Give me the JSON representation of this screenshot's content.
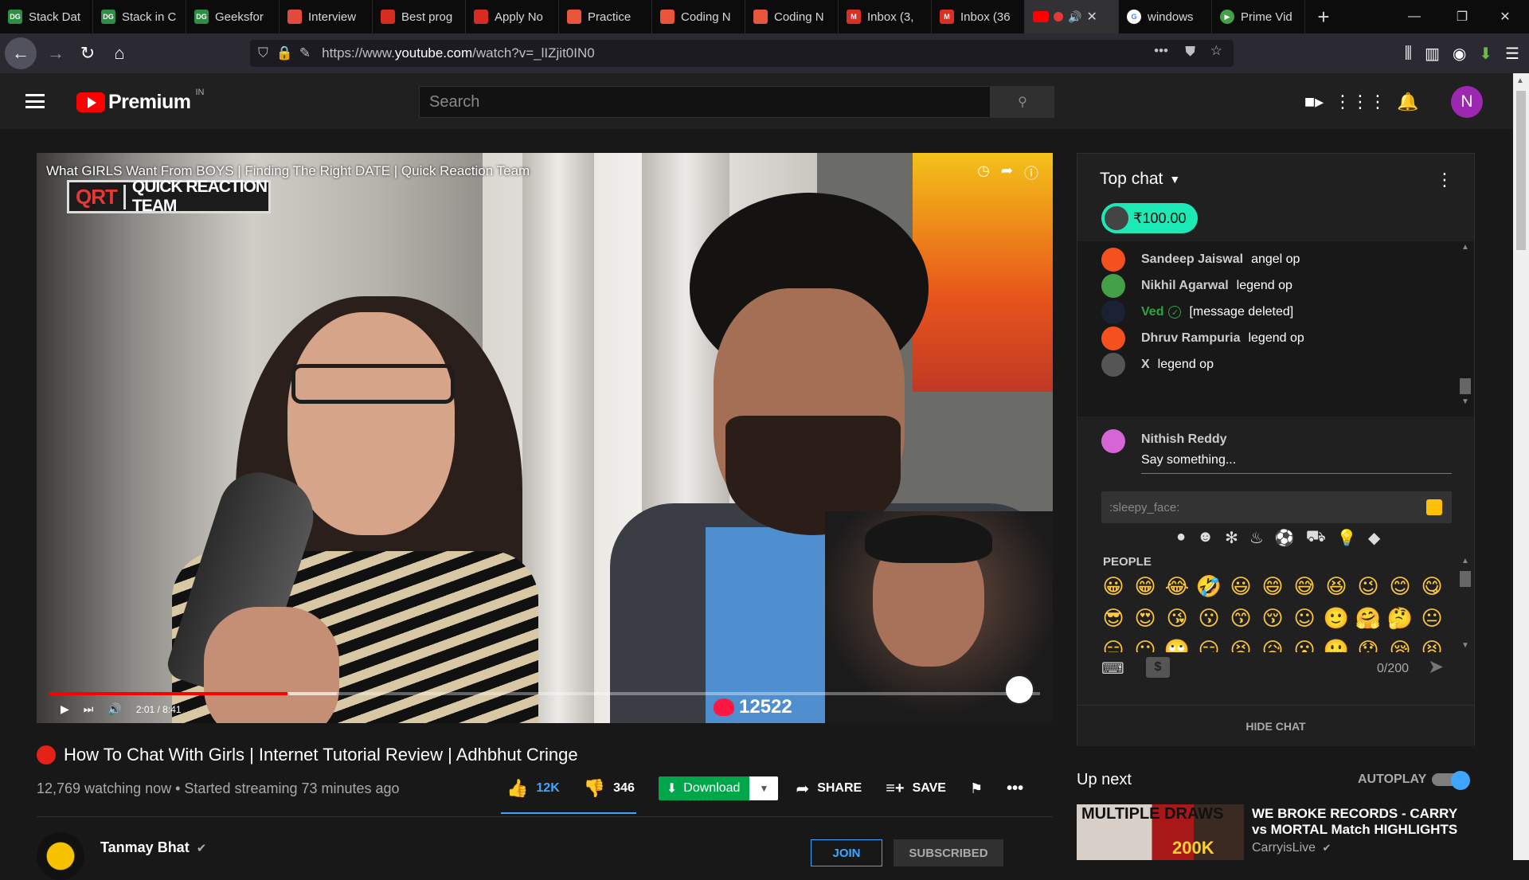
{
  "browser": {
    "tabs": [
      {
        "label": "Stack Dat",
        "icon": "gfg-favicon",
        "color": "#2f8d46",
        "abbr": "DG"
      },
      {
        "label": "Stack in C",
        "icon": "gfg-favicon",
        "color": "#2f8d46",
        "abbr": "DG"
      },
      {
        "label": "Geeksfor",
        "icon": "gfg-favicon",
        "color": "#2f8d46",
        "abbr": "DG"
      },
      {
        "label": "Interview",
        "icon": "interviewbit-favicon",
        "color": "#e24b3b",
        "abbr": ""
      },
      {
        "label": "Best prog",
        "icon": "red-favicon",
        "color": "#d62d20",
        "abbr": ""
      },
      {
        "label": "Apply No",
        "icon": "red-favicon",
        "color": "#d62d20",
        "abbr": ""
      },
      {
        "label": "Practice",
        "icon": "coding-favicon",
        "color": "#e8553b",
        "abbr": ""
      },
      {
        "label": "Coding N",
        "icon": "coding-favicon",
        "color": "#e8553b",
        "abbr": ""
      },
      {
        "label": "Coding N",
        "icon": "coding-favicon",
        "color": "#e8553b",
        "abbr": ""
      },
      {
        "label": "Inbox (3,",
        "icon": "gmail-favicon",
        "color": "#d93025",
        "abbr": "M"
      },
      {
        "label": "Inbox (36",
        "icon": "gmail-favicon",
        "color": "#d93025",
        "abbr": "M"
      }
    ],
    "active_tab_icons": [
      "youtube-icon",
      "record-icon",
      "speaker-icon",
      "close-icon"
    ],
    "after_tabs": [
      {
        "label": "windows",
        "icon": "google-favicon"
      },
      {
        "label": "Prime Vid",
        "icon": "prime-favicon"
      }
    ],
    "url_prefix": "https://www.",
    "url_host": "youtube.com",
    "url_path": "/watch?v=_lIZjit0IN0"
  },
  "youtube": {
    "logo_word": "Premium",
    "logo_region": "IN",
    "search_placeholder": "Search",
    "avatar_letter": "N"
  },
  "video": {
    "overlay_title": "What GIRLS Want From BOYS | Finding The Right DATE | Quick Reaction Team",
    "qrt_badge": "QRT",
    "qrt_text": "QUICK REACTION TEAM",
    "time": "2:01 / 8:41",
    "progress": 0.24,
    "buffered": 0.29,
    "likes_counter": "12522"
  },
  "info": {
    "title": "How To Chat With Girls | Internet Tutorial Review | Adhbhut Cringe",
    "meta": "12,769 watching now • Started streaming 73 minutes ago",
    "likes": "12K",
    "dislikes": "346",
    "download": "Download",
    "share": "SHARE",
    "save": "SAVE",
    "channel": "Tanmay Bhat",
    "join": "JOIN",
    "subscribed": "SUBSCRIBED"
  },
  "chat": {
    "title": "Top chat",
    "superchat_amount": "₹100.00",
    "messages": [
      {
        "author": "Sandeep Jaiswal",
        "text": "angel op",
        "color": "#f4511e"
      },
      {
        "author": "Nikhil Agarwal",
        "text": "legend op",
        "color": "#43a047"
      },
      {
        "author": "Ved",
        "text": "[message deleted]",
        "color": "#1a2233"
      },
      {
        "author": "Dhruv Rampuria",
        "text": "legend op",
        "color": "#f4511e"
      },
      {
        "author": "X",
        "text": "legend op",
        "color": "#555555"
      }
    ],
    "me_name": "Nithish Reddy",
    "say_placeholder": "Say something...",
    "emoji_search": ":sleepy_face:",
    "category": "PEOPLE",
    "emojis": [
      "😀",
      "😁",
      "😂",
      "🤣",
      "😃",
      "😄",
      "😅",
      "😆",
      "😉",
      "😊",
      "😋",
      "😎",
      "😍",
      "😘",
      "😗",
      "😙",
      "😚",
      "☺",
      "🙂",
      "🤗",
      "🤔",
      "😐",
      "😑",
      "😶",
      "🙄",
      "😏",
      "😣",
      "😥",
      "😮",
      "🤐",
      "😯",
      "😪",
      "😫"
    ],
    "counter": "0/200",
    "hide_chat": "HIDE CHAT"
  },
  "upnext": {
    "label": "Up next",
    "autoplay": "AUTOPLAY",
    "autoplay_on": true,
    "item": {
      "title": "WE BROKE RECORDS - CARRY vs MORTAL Match HIGHLIGHTS",
      "channel": "CarryisLive",
      "thumb_text_1": "MULTIPLE DRAWS",
      "thumb_text_2": "200K"
    }
  }
}
